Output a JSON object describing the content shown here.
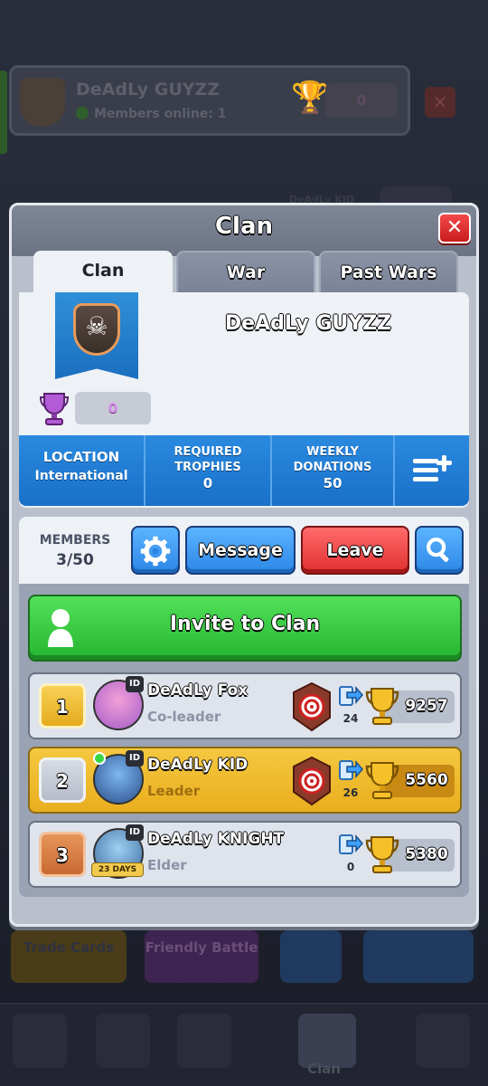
{
  "background": {
    "clan_name": "DeAdLy GUYZZ",
    "members_online": "Members online: 1",
    "trophies": "0",
    "member_hint": "DeAdLy KID",
    "bottom_buttons": [
      "Trade Cards",
      "Friendly Battle"
    ],
    "nav_active_label": "Clan"
  },
  "modal": {
    "title": "Clan",
    "close_icon": "close-x-icon",
    "tabs": [
      {
        "label": "Clan",
        "active": true
      },
      {
        "label": "War",
        "active": false
      },
      {
        "label": "Past Wars",
        "active": false
      }
    ]
  },
  "clan_info": {
    "name": "DeAdLy GUYZZ",
    "trophies": "0",
    "location_label": "LOCATION",
    "location_value": "International",
    "required_trophies_label_1": "REQUIRED",
    "required_trophies_label_2": "TROPHIES",
    "required_trophies_value": "0",
    "weekly_donations_label_1": "WEEKLY",
    "weekly_donations_label_2": "DONATIONS",
    "weekly_donations_value": "50",
    "menu_icon": "list-add-icon"
  },
  "members_section": {
    "members_label": "MEMBERS",
    "members_count": "3/50",
    "settings_icon": "gear-icon",
    "message_button": "Message",
    "leave_button": "Leave",
    "search_icon": "magnifier-icon",
    "invite_button": "Invite to Clan"
  },
  "members": [
    {
      "rank": "1",
      "name": "DeAdLy Fox",
      "role": "Co-leader",
      "donations": "24",
      "trophies": "9257",
      "id_tag": "ID",
      "highlight": false
    },
    {
      "rank": "2",
      "name": "DeAdLy KID",
      "role": "Leader",
      "donations": "26",
      "trophies": "5560",
      "id_tag": "ID",
      "highlight": true
    },
    {
      "rank": "3",
      "name": "DeAdLy KNIGHT",
      "role": "Elder",
      "donations": "0",
      "trophies": "5380",
      "id_tag": "ID",
      "days_tag": "23 DAYS",
      "highlight": false
    }
  ],
  "colors": {
    "accent_blue": "#2a8ae0",
    "invite_green": "#26b530",
    "leave_red": "#e02f2f",
    "highlight_gold": "#f4c840"
  }
}
